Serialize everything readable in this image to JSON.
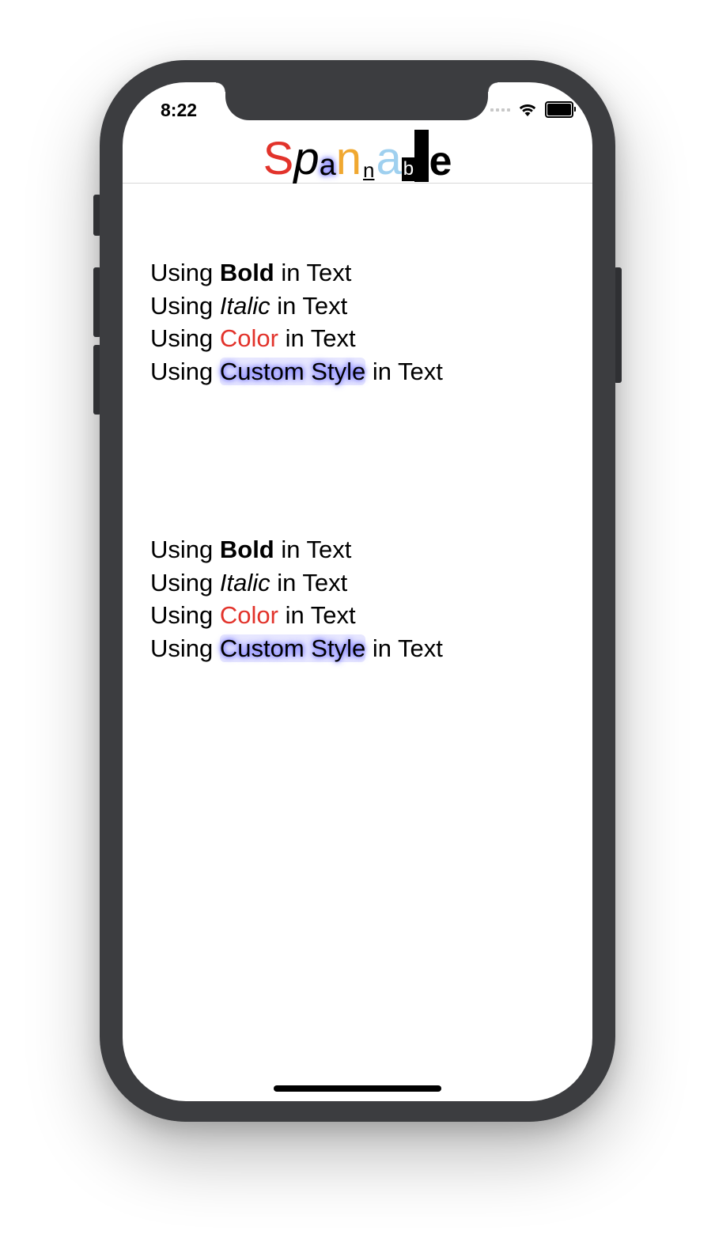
{
  "status_bar": {
    "time": "8:22",
    "icons": [
      "cellular-signal-icon",
      "wifi-icon",
      "battery-icon"
    ]
  },
  "nav": {
    "title_letters": [
      {
        "char": "S",
        "color": "#e2332b",
        "style": "large"
      },
      {
        "char": "p",
        "color": "#000000",
        "style": "italic-large"
      },
      {
        "char": "a",
        "color": "#000000",
        "style": "custom-glow"
      },
      {
        "char": "n",
        "color": "#f0a830",
        "style": "large"
      },
      {
        "char": "n",
        "color": "#000000",
        "style": "small-underline"
      },
      {
        "char": "a",
        "color": "#9fd0ef",
        "style": "large"
      },
      {
        "char": "b",
        "color": "#ffffff",
        "style": "small-inverted"
      },
      {
        "char": "l",
        "color": "#000000",
        "style": "tall-bold"
      },
      {
        "char": "e",
        "color": "#000000",
        "style": "bold-large"
      }
    ]
  },
  "blocks": [
    {
      "lines": [
        {
          "prefix": "Using ",
          "styled": "Bold",
          "suffix": " in Text"
        },
        {
          "prefix": "Using ",
          "styled": "Italic",
          "suffix": " in Text"
        },
        {
          "prefix": "Using ",
          "styled": "Color",
          "suffix": " in Text"
        },
        {
          "prefix": "Using ",
          "styled": "Custom Style",
          "suffix": " in Text"
        }
      ]
    },
    {
      "lines": [
        {
          "prefix": "Using ",
          "styled": "Bold",
          "suffix": " in Text"
        },
        {
          "prefix": "Using ",
          "styled": "Italic",
          "suffix": " in Text"
        },
        {
          "prefix": "Using ",
          "styled": "Color",
          "suffix": " in Text"
        },
        {
          "prefix": "Using ",
          "styled": "Custom Style",
          "suffix": " in Text"
        }
      ]
    }
  ],
  "colors": {
    "accent_red": "#e2332b",
    "accent_orange": "#f0a830",
    "accent_lightblue": "#9fd0ef",
    "custom_glow": "#5b5bff"
  }
}
